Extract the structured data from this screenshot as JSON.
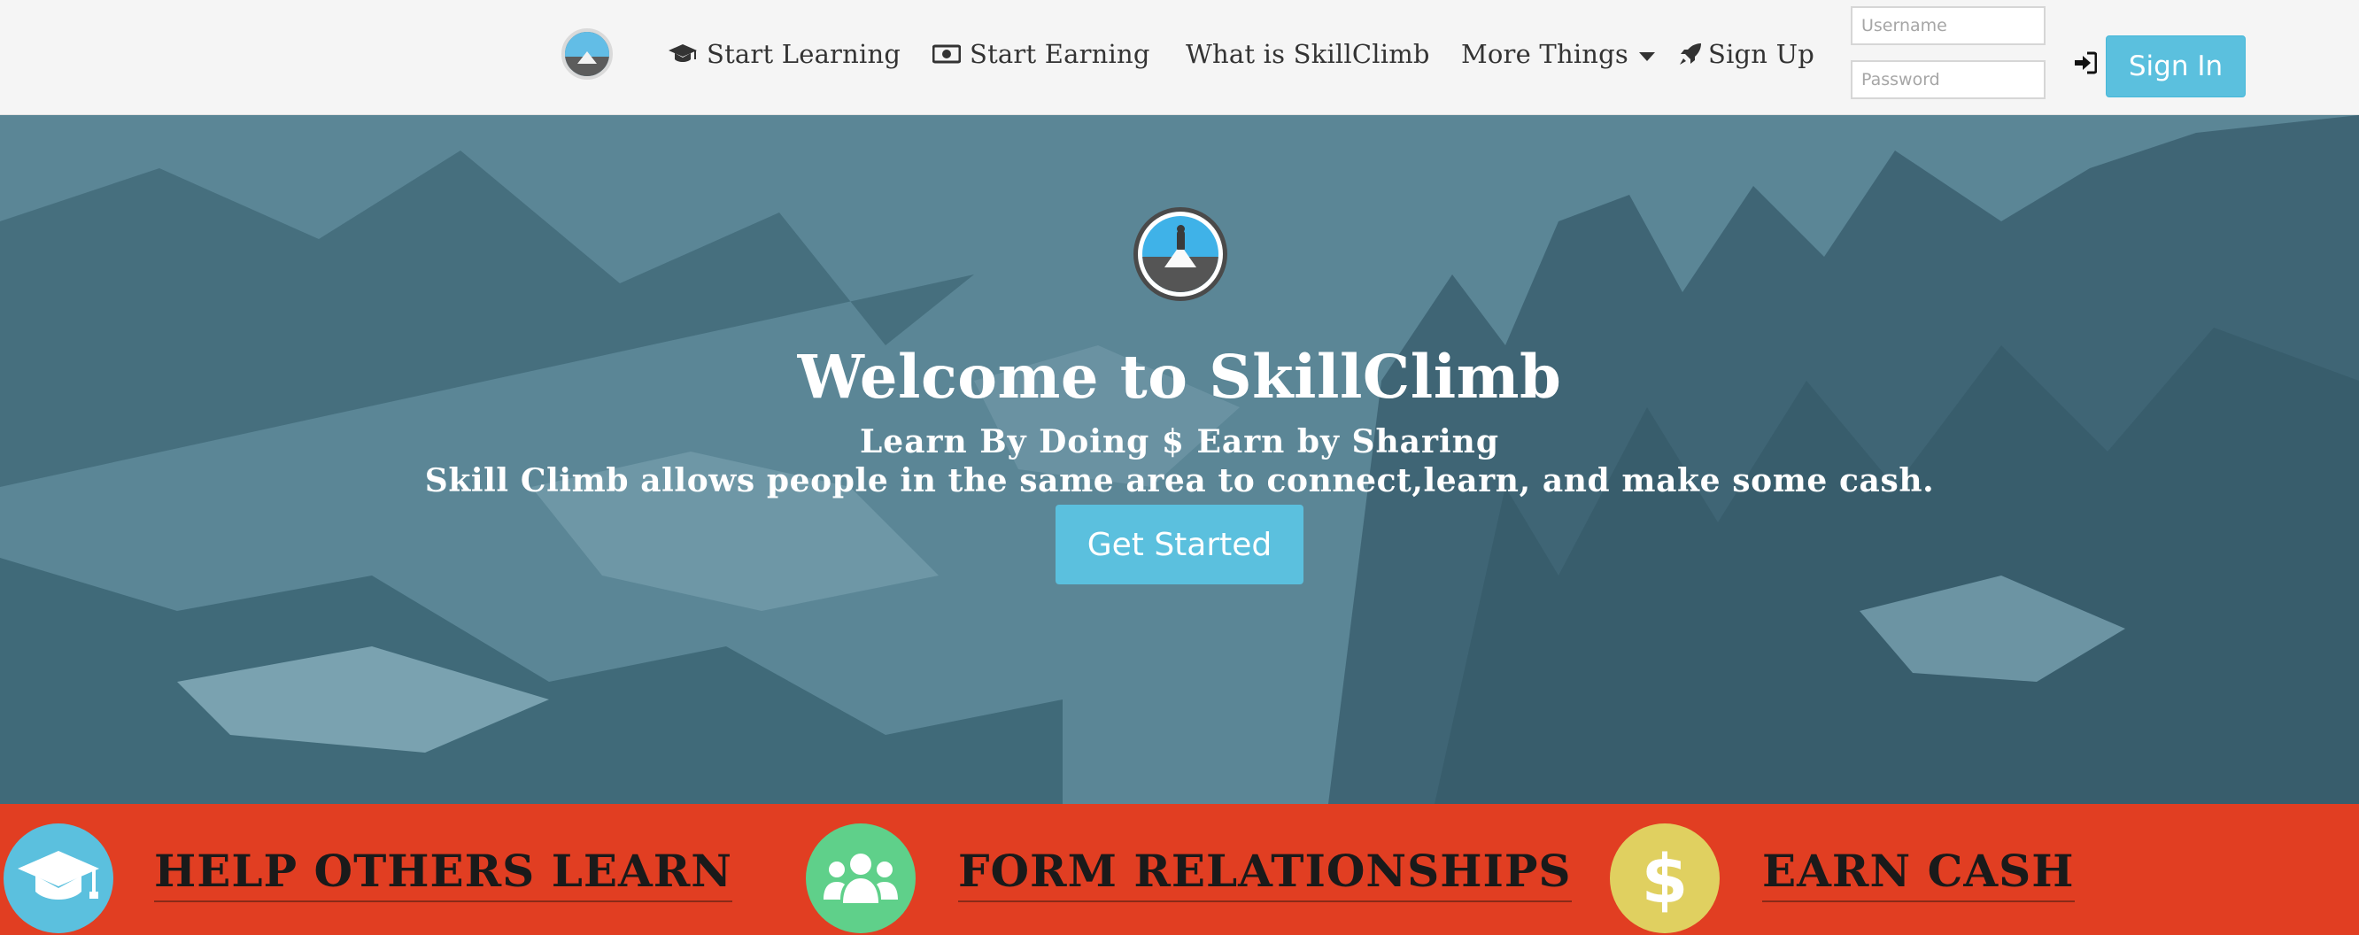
{
  "nav": {
    "items": [
      {
        "label": "Start Learning",
        "icon": "graduation-cap-icon"
      },
      {
        "label": "Start Earning",
        "icon": "money-bill-icon"
      },
      {
        "label": "What is SkillClimb"
      },
      {
        "label": "More Things",
        "icon": "caret-down-icon"
      },
      {
        "label": "Sign Up",
        "icon": "rocket-icon"
      }
    ],
    "username_placeholder": "Username",
    "password_placeholder": "Password",
    "signin_label": "Sign In"
  },
  "hero": {
    "title": "Welcome to SkillClimb",
    "subtitle1": "Learn By Doing $ Earn by Sharing",
    "subtitle2": "Skill Climb allows people in the same area to connect,learn, and make some cash.",
    "cta_label": "Get Started"
  },
  "features": [
    {
      "title": "HELP OTHERS LEARN",
      "icon": "graduation-cap-icon",
      "color": "#5bc0de"
    },
    {
      "title": "FORM RELATIONSHIPS",
      "icon": "users-icon",
      "color": "#5fd08a"
    },
    {
      "title": "EARN CASH",
      "icon": "dollar-icon",
      "color": "#e0d060",
      "symbol": "$"
    }
  ],
  "colors": {
    "accent": "#5bc0de",
    "hero_overlay": "#4d7684",
    "feature_band": "#e13e22",
    "navbar": "#f5f5f5"
  }
}
